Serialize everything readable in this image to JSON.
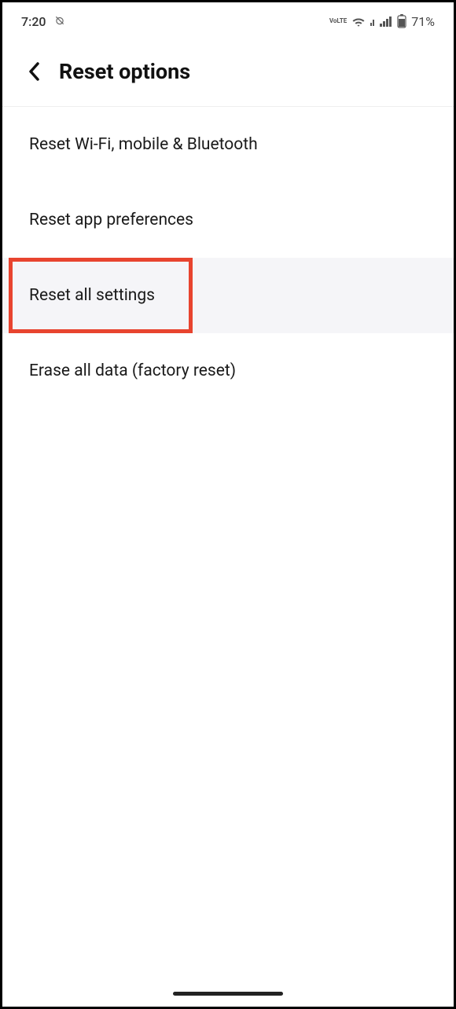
{
  "status_bar": {
    "time": "7:20",
    "lte_label": "VoLTE",
    "battery_percent": "71%"
  },
  "header": {
    "title": "Reset options"
  },
  "menu": {
    "items": [
      {
        "label": "Reset Wi-Fi, mobile & Bluetooth"
      },
      {
        "label": "Reset app preferences"
      },
      {
        "label": "Reset all settings"
      },
      {
        "label": "Erase all data (factory reset)"
      }
    ]
  }
}
